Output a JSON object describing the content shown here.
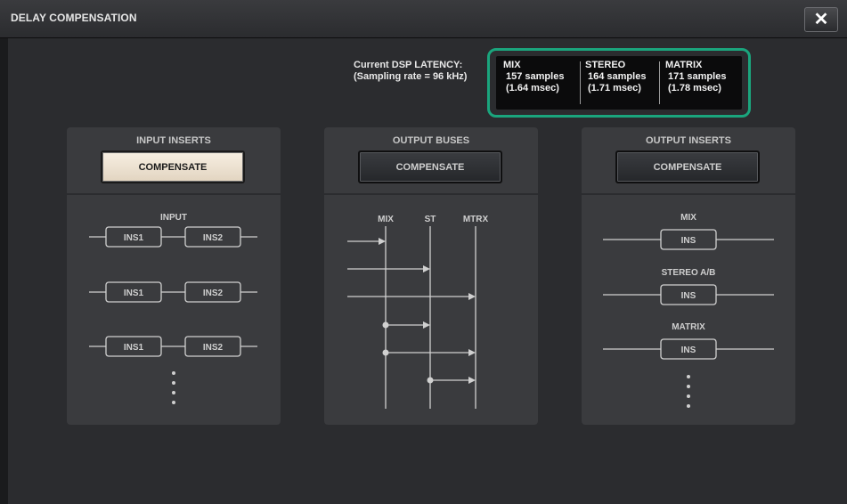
{
  "window": {
    "title": "DELAY COMPENSATION",
    "close_icon": "close-icon (×)",
    "close_glyph": "✕"
  },
  "latency": {
    "label_line1": "Current DSP LATENCY:",
    "label_line2": "(Sampling rate = 96 kHz)",
    "highlight_color": "#1aa57d",
    "columns": [
      {
        "name": "MIX",
        "samples": "157 samples",
        "msec": "(1.64 msec)"
      },
      {
        "name": "STEREO",
        "samples": "164 samples",
        "msec": "(1.71 msec)"
      },
      {
        "name": "MATRIX",
        "samples": "171 samples",
        "msec": "(1.78 msec)"
      }
    ]
  },
  "panels": {
    "input_inserts": {
      "title": "INPUT INSERTS",
      "button_label": "COMPENSATE",
      "button_state": "on",
      "diagram": {
        "header": "INPUT",
        "ins1": "INS1",
        "ins2": "INS2"
      }
    },
    "output_buses": {
      "title": "OUTPUT BUSES",
      "button_label": "COMPENSATE",
      "button_state": "off",
      "diagram": {
        "mix": "MIX",
        "st": "ST",
        "mtrx": "MTRX"
      }
    },
    "output_inserts": {
      "title": "OUTPUT INSERTS",
      "button_label": "COMPENSATE",
      "button_state": "off",
      "diagram": {
        "mix": "MIX",
        "stereo": "STEREO A/B",
        "matrix": "MATRIX",
        "ins": "INS"
      }
    }
  },
  "colors": {
    "button_on": "#f0e6d6",
    "panel": "#3a3b3e",
    "background": "#2b2c2f"
  }
}
